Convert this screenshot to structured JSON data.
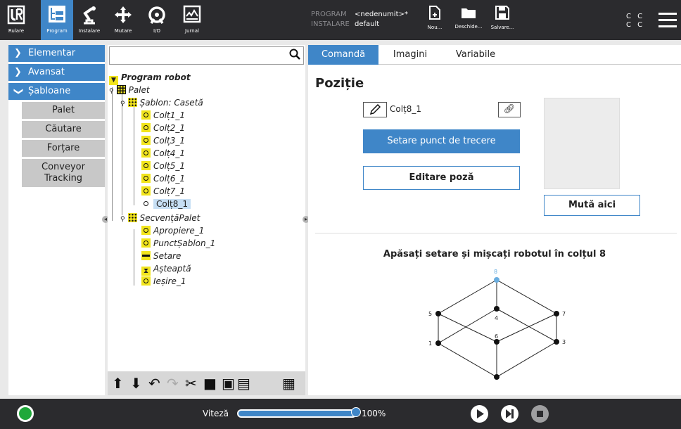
{
  "topbar": {
    "nav": [
      {
        "label": "Rulare",
        "icon": "ur-logo-icon"
      },
      {
        "label": "Program",
        "icon": "program-icon"
      },
      {
        "label": "Instalare",
        "icon": "robot-arm-icon"
      },
      {
        "label": "Mutare",
        "icon": "move-arrows-icon"
      },
      {
        "label": "I/O",
        "icon": "io-icon"
      },
      {
        "label": "Jurnal",
        "icon": "log-icon"
      }
    ],
    "program_key": "PROGRAM",
    "program_val": "<nedenumit>*",
    "install_key": "INSTALARE",
    "install_val": "default",
    "file": [
      {
        "label": "Nou...",
        "icon": "new-file-icon"
      },
      {
        "label": "Deschide...",
        "icon": "folder-icon"
      },
      {
        "label": "Salvare...",
        "icon": "save-icon"
      }
    ],
    "cc_line1": "C C",
    "cc_line2": "C C"
  },
  "leftnav": {
    "items": [
      "Elementar",
      "Avansat",
      "Șabloane"
    ],
    "sub_items": [
      "Palet",
      "Căutare",
      "Forțare",
      "Conveyor Tracking"
    ]
  },
  "tree": {
    "search_placeholder": "",
    "root": "Program robot",
    "palet": "Palet",
    "sablon": "Șablon: Casetă",
    "corners": [
      "Colț1_1",
      "Colț2_1",
      "Colț3_1",
      "Colț4_1",
      "Colț5_1",
      "Colț6_1",
      "Colț7_1",
      "Colț8_1"
    ],
    "secventa": "SecvențăPalet",
    "seq_items": [
      "Apropiere_1",
      "PunctȘablon_1",
      "Setare",
      "Așteaptă",
      "Ieșire_1"
    ]
  },
  "right": {
    "tabs": [
      "Comandă",
      "Imagini",
      "Variabile"
    ],
    "title": "Poziție",
    "waypoint_name": "Colț8_1",
    "set_waypoint": "Setare punct de trecere",
    "edit_pose": "Editare poză",
    "move_here": "Mută aici",
    "instruction": "Apăsați setare și mișcați robotul în colțul 8",
    "diagram_labels": [
      "8",
      "4",
      "5",
      "7",
      "6",
      "1",
      "3"
    ]
  },
  "bottombar": {
    "speed_label": "Viteză",
    "speed_value": "100%",
    "speed_fraction": 1.0
  },
  "colors": {
    "accent": "#3f86c8",
    "bar_bg": "#2b2b2e",
    "node_yellow": "#f2e51c",
    "power_green": "#1fa83a"
  }
}
